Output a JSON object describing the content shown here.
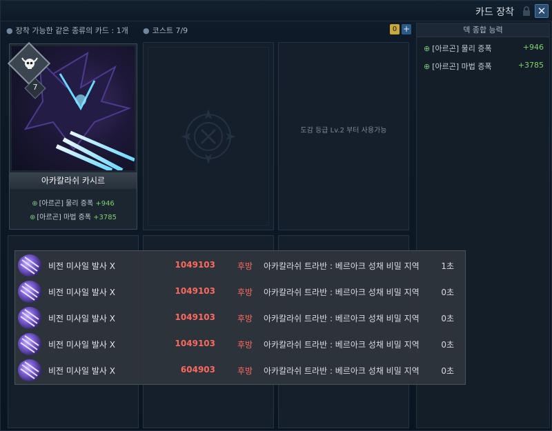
{
  "window": {
    "title": "카드 장착"
  },
  "infobar": {
    "same_card_limit": "장착 가능한 같은 종류의 카드 : 1개",
    "cost": "코스트 7/9",
    "cost_badge": "0",
    "plus": "+"
  },
  "card": {
    "level": "7",
    "name": "아카칼라쉬 카시르",
    "stats": [
      {
        "label": "[아르곤] 물리 증폭",
        "value": "+946"
      },
      {
        "label": "[아르곤] 마법 증폭",
        "value": "+3785"
      }
    ]
  },
  "slots": {
    "locked_note": "도감 등급 Lv.2 부터 사용가능"
  },
  "deck_panel": {
    "header": "덱 종합 능력",
    "stats": [
      {
        "label": "[아르곤] 물리 증폭",
        "value": "+946"
      },
      {
        "label": "[아르곤] 마법 증폭",
        "value": "+3785"
      }
    ]
  },
  "combat_log": [
    {
      "skill": "비전 미사일 발사 X",
      "damage": "1049103",
      "type": "후방",
      "target": "아카칼라쉬 트라반 : 베르아크 성채 비밀 지역",
      "time": "1초"
    },
    {
      "skill": "비전 미사일 발사 X",
      "damage": "1049103",
      "type": "후방",
      "target": "아카칼라쉬 트라반 : 베르아크 성채 비밀 지역",
      "time": "0초"
    },
    {
      "skill": "비전 미사일 발사 X",
      "damage": "1049103",
      "type": "후방",
      "target": "아카칼라쉬 트라반 : 베르아크 성채 비밀 지역",
      "time": "0초"
    },
    {
      "skill": "비전 미사일 발사 X",
      "damage": "1049103",
      "type": "후방",
      "target": "아카칼라쉬 트라반 : 베르아크 성채 비밀 지역",
      "time": "0초"
    },
    {
      "skill": "비전 미사일 발사 X",
      "damage": "604903",
      "type": "후방",
      "target": "아카칼라쉬 트라반 : 베르아크 성채 비밀 지역",
      "time": "0초"
    }
  ],
  "colors": {
    "damage": "#ff6a5f",
    "stat_value": "#7fd46b",
    "cost_badge": "#c9a83a"
  },
  "icons": {
    "card_type": "horned-skull-icon",
    "stat": "crosshair-icon",
    "skill": "arcane-missile-icon"
  }
}
